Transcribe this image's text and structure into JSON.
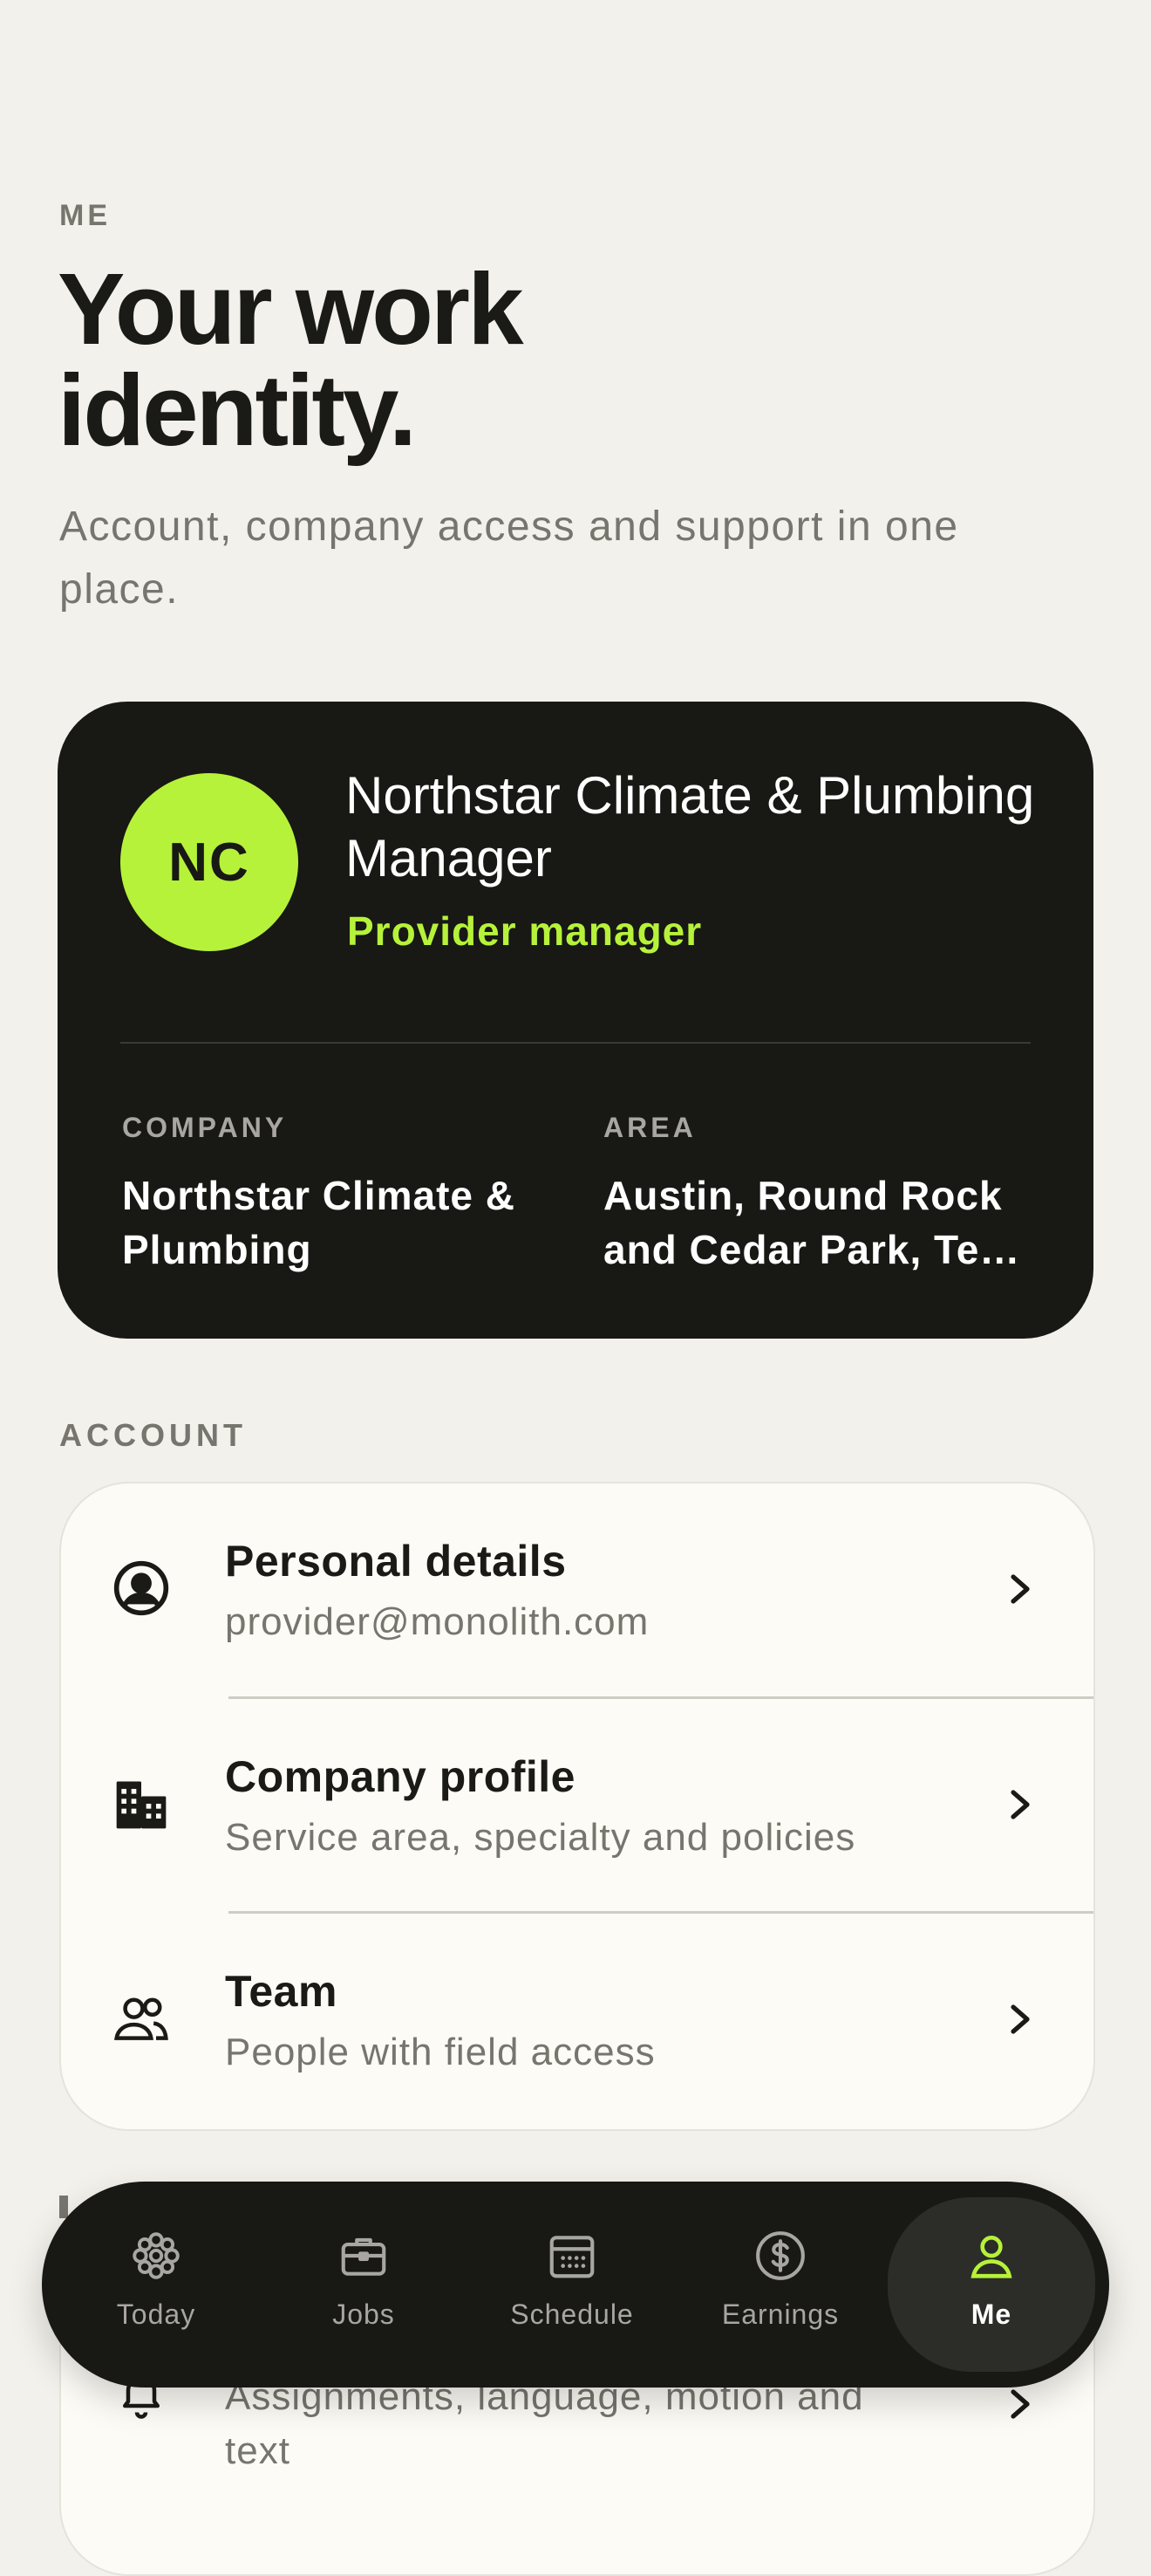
{
  "header": {
    "eyebrow": "ME",
    "title": "Your work\nidentity.",
    "subtitle": "Account, company access and support in one place."
  },
  "identity": {
    "initials": "NC",
    "name": "Northstar Climate & Plumbing Manager",
    "role": "Provider manager",
    "company_label": "COMPANY",
    "company_value": "Northstar Climate & Plumbing",
    "area_label": "AREA",
    "area_value": "Austin, Round Rock and Cedar Park, Te…"
  },
  "account": {
    "section_label": "ACCOUNT",
    "items": [
      {
        "title": "Personal details",
        "subtitle": "provider@monolith.com",
        "icon": "user-circle-icon"
      },
      {
        "title": "Company profile",
        "subtitle": "Service area, specialty and policies",
        "icon": "building-icon"
      },
      {
        "title": "Team",
        "subtitle": "People with field access",
        "icon": "team-icon"
      }
    ]
  },
  "notifications_peek": {
    "subtitle": "Assignments, language, motion and text",
    "icon": "bell-icon"
  },
  "tabbar": {
    "tabs": [
      {
        "label": "Today",
        "icon": "flower-icon"
      },
      {
        "label": "Jobs",
        "icon": "briefcase-icon"
      },
      {
        "label": "Schedule",
        "icon": "calendar-icon"
      },
      {
        "label": "Earnings",
        "icon": "dollar-icon"
      },
      {
        "label": "Me",
        "icon": "person-icon",
        "active": true
      }
    ]
  },
  "colors": {
    "accent": "#b6f23a",
    "dark_surface": "#181815",
    "background": "#f3f1eb",
    "card": "#fdfbf5",
    "muted_text": "#77756e"
  }
}
